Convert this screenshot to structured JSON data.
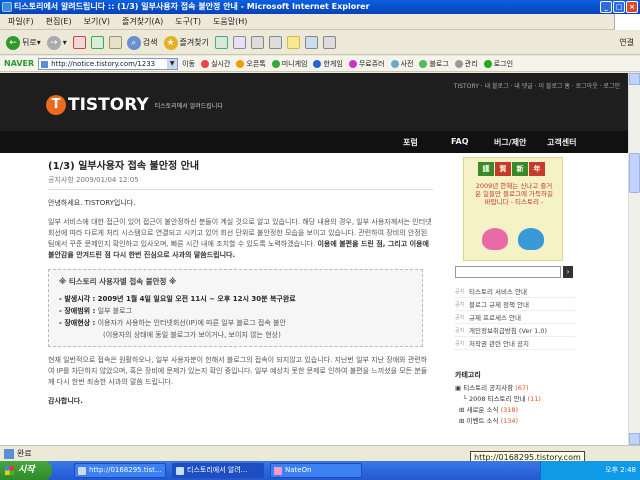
{
  "window": {
    "title": "티스토리에서 알려드립니다 :: (1/3) 일부사용자 접속 불안정 안내 - Microsoft Internet Explorer"
  },
  "menu": [
    "파일(F)",
    "편집(E)",
    "보기(V)",
    "즐겨찾기(A)",
    "도구(T)",
    "도움말(H)"
  ],
  "toolbar": {
    "back": "뒤로",
    "search": "검색",
    "favorites": "즐겨찾기",
    "links": "연결"
  },
  "naverbar": {
    "logo": "NAVER",
    "address": "http://notice.tistory.com/1233",
    "go": "이동",
    "items": [
      "실시간",
      "오픈톡",
      "미니게임",
      "한게임",
      "무료쥬러",
      "사전",
      "블로그",
      "관리",
      "로그인"
    ]
  },
  "site": {
    "toplinks": "TISTORY · 내 블로그 · 내 댓글 · 이 블로그 홈 · 로그아웃 · 로그인",
    "toplinks_logo": "TISTORY",
    "logo_text": "TISTORY",
    "logo_sub": "티스토리에서 알려드립니다",
    "nav": [
      "포럼",
      "FAQ",
      "버그/제안",
      "고객센터"
    ]
  },
  "post": {
    "title": "(1/3) 일부사용자 접속 불안정 안내",
    "category": "공지사항",
    "date": "2009/01/04 12:05",
    "greeting": "안녕하세요. TISTORY입니다.",
    "body1": "일부 서비스에 대한 접근이 있어 접근이 불안정하신 분들이 계실 것으로 알고 있습니다. 해당 내용의 경우, 일부 사용자께서는 인터넷회선에 따라 다르게 처리 시스템으로 연결되고 시키고 있어 회선 단위로 불안정한 모습을 보이고 있습니다. 관련하여 장비의 안정된 팀에서 꾸준 문제인지 확인하고 있사오며, 빠른 시간 내에 조치할 수 있도록 노력하겠습니다.",
    "body1_bold": "이용에 불편을 드린 점, 그리고 이용에 불안감을 안겨드린 점 다시 한번 진심으로 사과의 말씀드립니다.",
    "notice_title": "※ 티스토리 사용자별 접속 불안정 ※",
    "notice_items": [
      {
        "label": "- 발생시각 :",
        "value": "2009년 1월 4일 일요일 오전 11시 ~ 오후 12시 30분 복구완료"
      },
      {
        "label": "- 장애범위 :",
        "value": "일부 블로그"
      },
      {
        "label": "- 장애현상 :",
        "value": "이용자가 사용하는 인터넷회선(IP)에 따른 일부 블로그 접속 불안"
      },
      {
        "label": "",
        "value": "(이용자의 상태에 동일 블로그가 보이거나, 보이지 않는 현상)"
      }
    ],
    "body2": "현재 일반적으로 접속은 원활하오나, 일부 사용자분이 한해서 블로그의 접속이 되지않고 있습니다. 지난번 일부 지난 장애와 관련하여 IP를 차단하지 않았으며, 혹은 장비에 문제가 있는지 확인 중입니다. 일부 예상치 못한 문제로 인하여 불편을 느끼셨을 모든 분들께 다시 한번 죄송한 사과의 말씀 드립니다.",
    "thanks": "감사합니다."
  },
  "sidebar": {
    "banner_chars": [
      "謹",
      "賀",
      "新",
      "年"
    ],
    "banner_msg": "2009년 한해는 신나고 즐거운 일들만 블로그에 가득하길 바랍니다 - 티스토리 -",
    "search_btn": "›",
    "notice_tag": "공지",
    "notices": [
      "티스토리 서비스 안내",
      "블로그 규제 정책 안내",
      "규제 프로세스 안내",
      "게인정보취급방침 (Ver 1.0)",
      "저작권 관련 안내 공지"
    ],
    "category_title": "카테고리",
    "categories": [
      {
        "name": "티스토리 공지사항",
        "count": "(67)"
      },
      {
        "name": "2008 티스토리 안내",
        "count": "(11)"
      },
      {
        "name": "새로운 소식",
        "count": "(318)"
      },
      {
        "name": "이벤트 소식",
        "count": "(134)"
      }
    ]
  },
  "status": {
    "text": "완료"
  },
  "taskbar": {
    "start": "시작",
    "tasks": [
      "http://0168295.tist...",
      "티스토리에서 알려...",
      "NateOn"
    ],
    "clock": "오후 2:48"
  },
  "tooltip": "http://0168295.tistory.com"
}
